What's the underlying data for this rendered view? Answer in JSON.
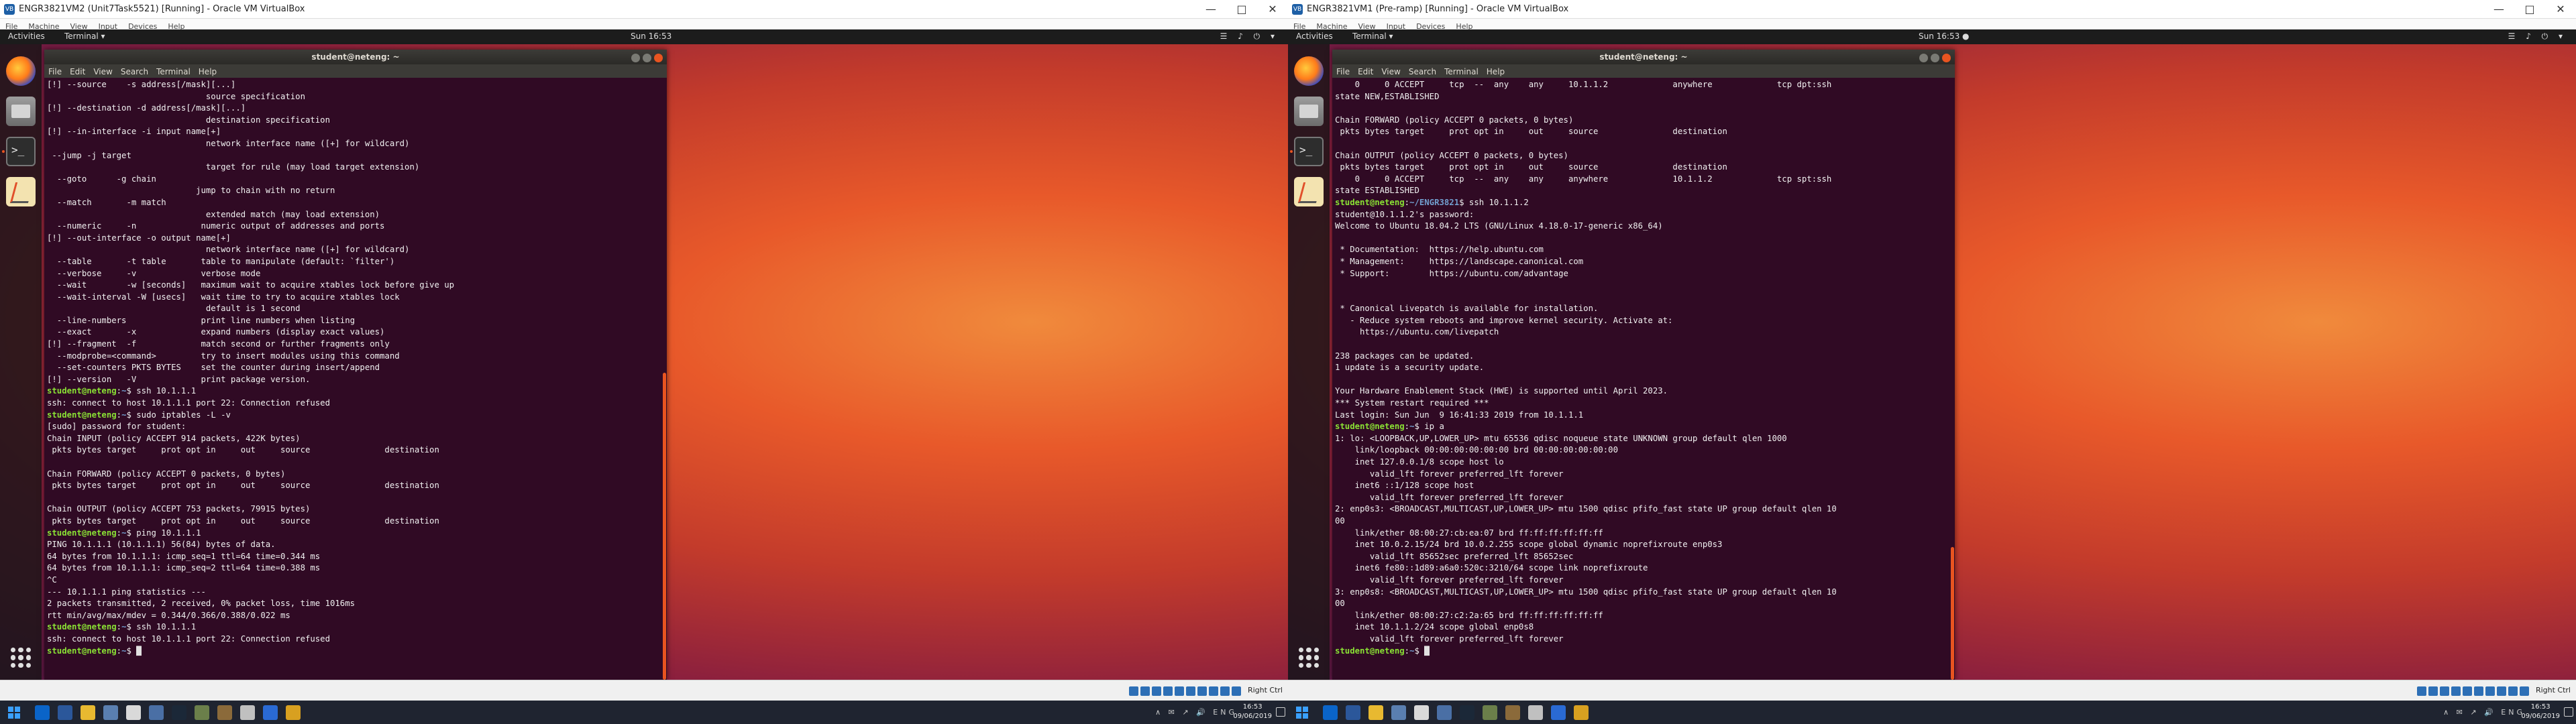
{
  "vms": [
    {
      "title": "ENGR3821VM2 (Unit7Task5521) [Running] - Oracle VM VirtualBox",
      "menu": [
        "File",
        "Machine",
        "View",
        "Input",
        "Devices",
        "Help"
      ],
      "gnome": {
        "activities": "Activities",
        "app_menu": "Terminal ▾",
        "clock": "Sun 16:53",
        "tray": "☰ ♪ ⏻ ▾"
      },
      "terminal": {
        "title": "student@neteng: ~",
        "menu": [
          "File",
          "Edit",
          "View",
          "Search",
          "Terminal",
          "Help"
        ],
        "lines": [
          "[!] --source    -s address[/mask][...]",
          "                                source specification",
          "[!] --destination -d address[/mask][...]",
          "                                destination specification",
          "[!] --in-interface -i input name[+]",
          "                                network interface name ([+] for wildcard)",
          " --jump -j target",
          "                                target for rule (may load target extension)",
          "  --goto      -g chain",
          "                              jump to chain with no return",
          "  --match       -m match",
          "                                extended match (may load extension)",
          "  --numeric     -n             numeric output of addresses and ports",
          "[!] --out-interface -o output name[+]",
          "                                network interface name ([+] for wildcard)",
          "  --table       -t table       table to manipulate (default: `filter')",
          "  --verbose     -v             verbose mode",
          "  --wait        -w [seconds]   maximum wait to acquire xtables lock before give up",
          "  --wait-interval -W [usecs]   wait time to try to acquire xtables lock",
          "                                default is 1 second",
          "  --line-numbers               print line numbers when listing",
          "  --exact       -x             expand numbers (display exact values)",
          "[!] --fragment  -f             match second or further fragments only",
          "  --modprobe=<command>         try to insert modules using this command",
          "  --set-counters PKTS BYTES    set the counter during insert/append",
          "[!] --version   -V             print package version.",
          "$P~$ ssh 10.1.1.1",
          "ssh: connect to host 10.1.1.1 port 22: Connection refused",
          "$P~$ sudo iptables -L -v",
          "[sudo] password for student:",
          "Chain INPUT (policy ACCEPT 914 packets, 422K bytes)",
          " pkts bytes target     prot opt in     out     source               destination",
          "",
          "Chain FORWARD (policy ACCEPT 0 packets, 0 bytes)",
          " pkts bytes target     prot opt in     out     source               destination",
          "",
          "Chain OUTPUT (policy ACCEPT 753 packets, 79915 bytes)",
          " pkts bytes target     prot opt in     out     source               destination",
          "$P~$ ping 10.1.1.1",
          "PING 10.1.1.1 (10.1.1.1) 56(84) bytes of data.",
          "64 bytes from 10.1.1.1: icmp_seq=1 ttl=64 time=0.344 ms",
          "64 bytes from 10.1.1.1: icmp_seq=2 ttl=64 time=0.388 ms",
          "^C",
          "--- 10.1.1.1 ping statistics ---",
          "2 packets transmitted, 2 received, 0% packet loss, time 1016ms",
          "rtt min/avg/max/mdev = 0.344/0.366/0.388/0.022 ms",
          "$P~$ ssh 10.1.1.1",
          "ssh: connect to host 10.1.1.1 port 22: Connection refused",
          "$P~$ "
        ]
      },
      "statusbar": {
        "host_key": "Right Ctrl"
      }
    },
    {
      "title": "ENGR3821VM1 (Pre-ramp) [Running] - Oracle VM VirtualBox",
      "menu": [
        "File",
        "Machine",
        "View",
        "Input",
        "Devices",
        "Help"
      ],
      "gnome": {
        "activities": "Activities",
        "app_menu": "Terminal ▾",
        "clock": "Sun 16:53 ●",
        "tray": "☰ ♪ ⏻ ▾"
      },
      "terminal": {
        "title": "student@neteng: ~",
        "menu": [
          "File",
          "Edit",
          "View",
          "Search",
          "Terminal",
          "Help"
        ],
        "lines": [
          "    0     0 ACCEPT     tcp  --  any    any     10.1.1.2             anywhere             tcp dpt:ssh",
          "state NEW,ESTABLISHED",
          "",
          "Chain FORWARD (policy ACCEPT 0 packets, 0 bytes)",
          " pkts bytes target     prot opt in     out     source               destination",
          "",
          "Chain OUTPUT (policy ACCEPT 0 packets, 0 bytes)",
          " pkts bytes target     prot opt in     out     source               destination",
          "    0     0 ACCEPT     tcp  --  any    any     anywhere             10.1.1.2             tcp spt:ssh",
          "state ESTABLISHED",
          "$P~/ENGR3821$ ssh 10.1.1.2",
          "student@10.1.1.2's password:",
          "Welcome to Ubuntu 18.04.2 LTS (GNU/Linux 4.18.0-17-generic x86_64)",
          "",
          " * Documentation:  https://help.ubuntu.com",
          " * Management:     https://landscape.canonical.com",
          " * Support:        https://ubuntu.com/advantage",
          "",
          "",
          " * Canonical Livepatch is available for installation.",
          "   - Reduce system reboots and improve kernel security. Activate at:",
          "     https://ubuntu.com/livepatch",
          "",
          "238 packages can be updated.",
          "1 update is a security update.",
          "",
          "Your Hardware Enablement Stack (HWE) is supported until April 2023.",
          "*** System restart required ***",
          "Last login: Sun Jun  9 16:41:33 2019 from 10.1.1.1",
          "$P~$ ip a",
          "1: lo: <LOOPBACK,UP,LOWER_UP> mtu 65536 qdisc noqueue state UNKNOWN group default qlen 1000",
          "    link/loopback 00:00:00:00:00:00 brd 00:00:00:00:00:00",
          "    inet 127.0.0.1/8 scope host lo",
          "       valid_lft forever preferred_lft forever",
          "    inet6 ::1/128 scope host",
          "       valid_lft forever preferred_lft forever",
          "2: enp0s3: <BROADCAST,MULTICAST,UP,LOWER_UP> mtu 1500 qdisc pfifo_fast state UP group default qlen 10",
          "00",
          "    link/ether 08:00:27:cb:ea:07 brd ff:ff:ff:ff:ff:ff",
          "    inet 10.0.2.15/24 brd 10.0.2.255 scope global dynamic noprefixroute enp0s3",
          "       valid_lft 85652sec preferred_lft 85652sec",
          "    inet6 fe80::1d89:a6a0:520c:3210/64 scope link noprefixroute",
          "       valid_lft forever preferred_lft forever",
          "3: enp0s8: <BROADCAST,MULTICAST,UP,LOWER_UP> mtu 1500 qdisc pfifo_fast state UP group default qlen 10",
          "00",
          "    link/ether 08:00:27:c2:2a:65 brd ff:ff:ff:ff:ff:ff",
          "    inet 10.1.1.2/24 scope global enp0s8",
          "       valid_lft forever preferred_lft forever",
          "$P~$ "
        ]
      },
      "statusbar": {
        "host_key": "Right Ctrl"
      }
    }
  ],
  "prompt": {
    "user_host": "student@neteng",
    "colon": ":"
  },
  "taskbars": [
    {
      "tray": "∧ ✉ ↗ 🔊 ENG",
      "time": "16:53",
      "date": "09/06/2019"
    },
    {
      "tray": "∧ ✉ ↗ 🔊 ENG",
      "time": "16:53",
      "date": "09/06/2019"
    }
  ],
  "icons": [
    "firefox-icon",
    "files-icon",
    "terminal-icon",
    "text-editor-icon",
    "show-apps-icon",
    "windows-start-icon"
  ]
}
